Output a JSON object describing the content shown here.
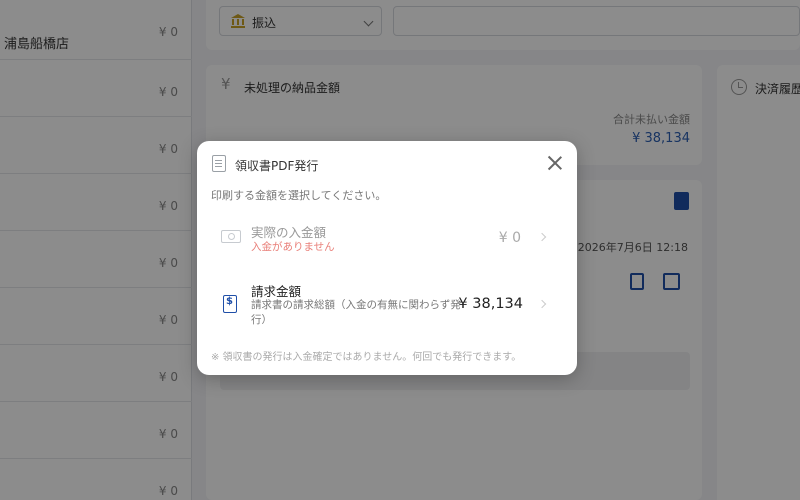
{
  "store_list": {
    "rows": [
      {
        "name": "浦島船橋店",
        "amount": "¥ 0"
      },
      {
        "name": "",
        "amount": "¥ 0"
      },
      {
        "name": "",
        "amount": "¥ 0"
      },
      {
        "name": "",
        "amount": "¥ 0"
      },
      {
        "name": "",
        "amount": "¥ 0"
      },
      {
        "name": "",
        "amount": "¥ 0"
      },
      {
        "name": "",
        "amount": "¥ 0"
      },
      {
        "name": "",
        "amount": "¥ 0"
      },
      {
        "name": "",
        "amount": "¥ 0"
      }
    ]
  },
  "payment": {
    "method": "振込",
    "bank_icon": "bank-icon"
  },
  "unpaid_card": {
    "title": "未処理の納品金額",
    "total_label": "合計未払い金額",
    "total_value": "¥ 38,134"
  },
  "history_card": {
    "title": "決済履歴"
  },
  "invoice_card": {
    "date": "2026年7月6日 12:18"
  },
  "modal": {
    "title": "領収書PDF発行",
    "instruction": "印刷する金額を選択してください。",
    "options": [
      {
        "title": "実際の入金額",
        "subtitle": "入金がありません",
        "amount": "¥ 0",
        "icon": "cash-icon",
        "disabled": true
      },
      {
        "title": "請求金額",
        "subtitle": "請求書の請求総額（入金の有無に関わらず発行）",
        "amount": "¥ 38,134",
        "icon": "invoice-dollar-icon",
        "disabled": false
      }
    ],
    "note": "※ 領収書の発行は入金確定ではありません。何回でも発行できます。"
  },
  "colors": {
    "accent": "#1f4fa8",
    "link_amount": "#2c5fb3",
    "error_text": "#e9807a",
    "overlay": "rgba(0,0,0,0.45)"
  }
}
